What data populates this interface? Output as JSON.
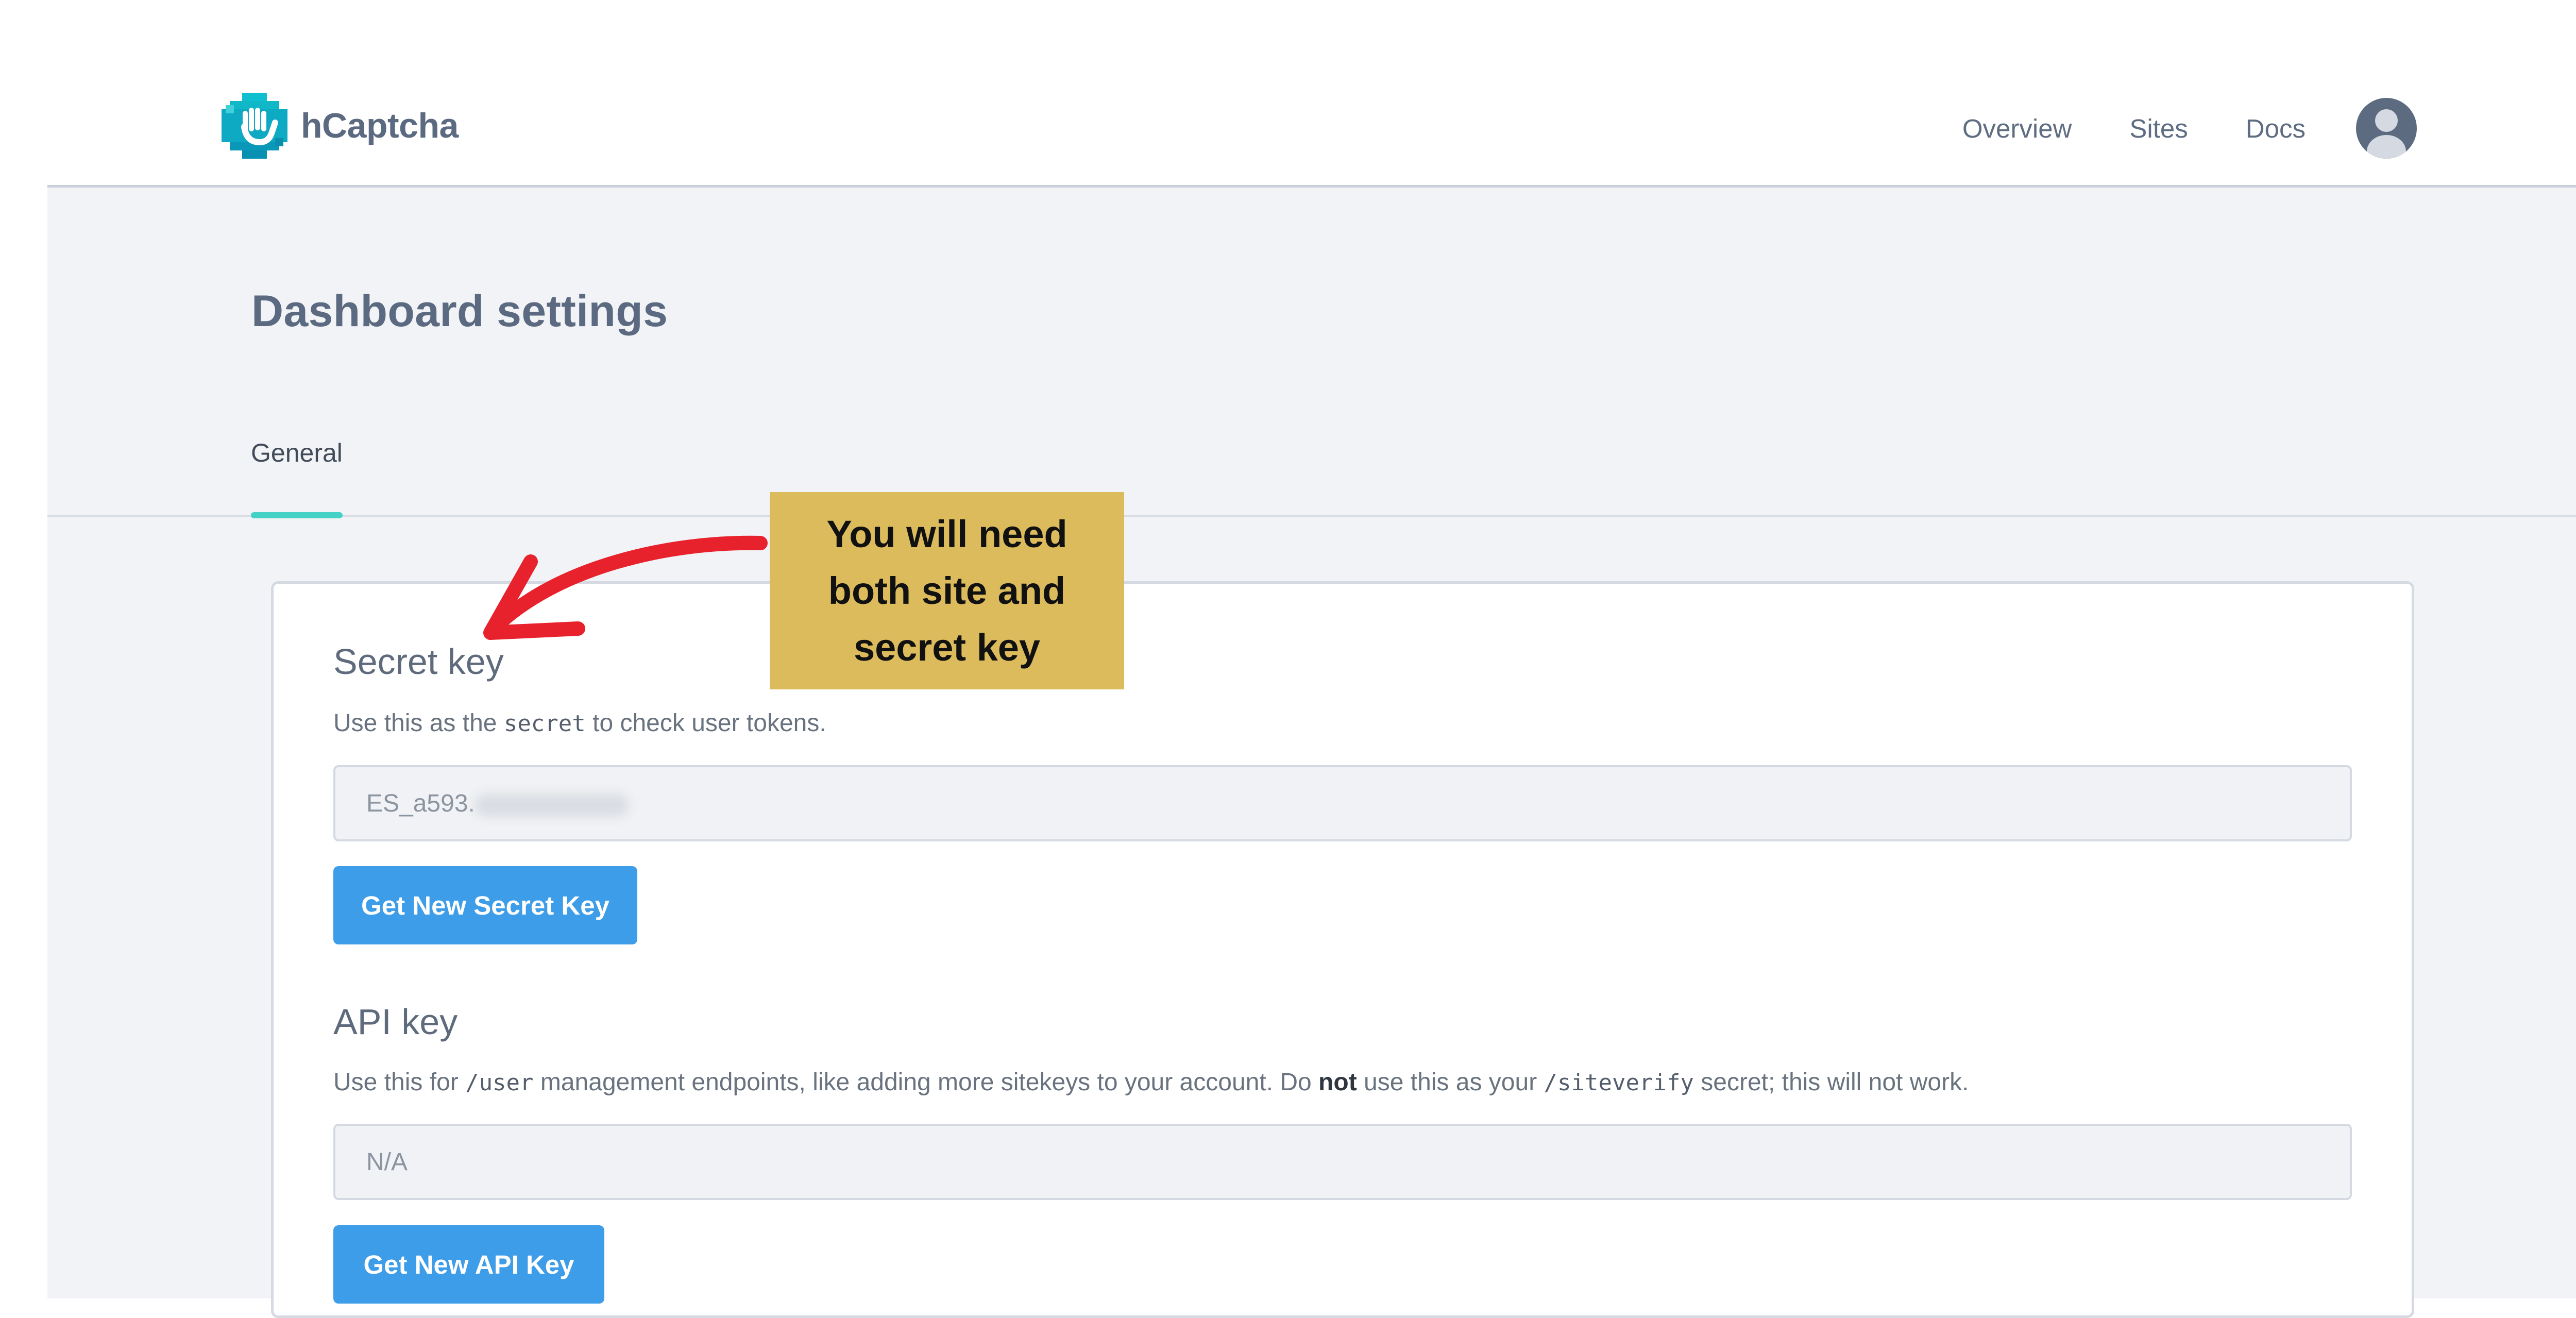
{
  "header": {
    "brand": "hCaptcha",
    "nav": [
      {
        "label": "Overview"
      },
      {
        "label": "Sites"
      },
      {
        "label": "Docs"
      }
    ]
  },
  "page": {
    "title": "Dashboard settings",
    "tabs": [
      {
        "label": "General",
        "active": true
      }
    ]
  },
  "secret_key": {
    "title": "Secret key",
    "desc_before": "Use this as the ",
    "desc_code": "secret",
    "desc_after": " to check user tokens.",
    "value": "ES_a593.",
    "button": "Get New Secret Key"
  },
  "api_key": {
    "title": "API key",
    "desc_1": "Use this for ",
    "desc_code_1": "/user",
    "desc_2": " management endpoints, like adding more sitekeys to your account. Do ",
    "desc_bold": "not",
    "desc_3": " use this as your ",
    "desc_code_2": "/siteverify",
    "desc_4": " secret; this will not work.",
    "value": "N/A",
    "button": "Get New API Key"
  },
  "annotation": {
    "line_1": "You will need",
    "line_2": "both site and",
    "line_3": "secret key"
  },
  "colors": {
    "accent": "#3d9de8",
    "tab_indicator": "#44d1c6",
    "callout_bg": "#dbbb5c",
    "arrow": "#e8222c",
    "logo_teal": "#10b7c7"
  }
}
